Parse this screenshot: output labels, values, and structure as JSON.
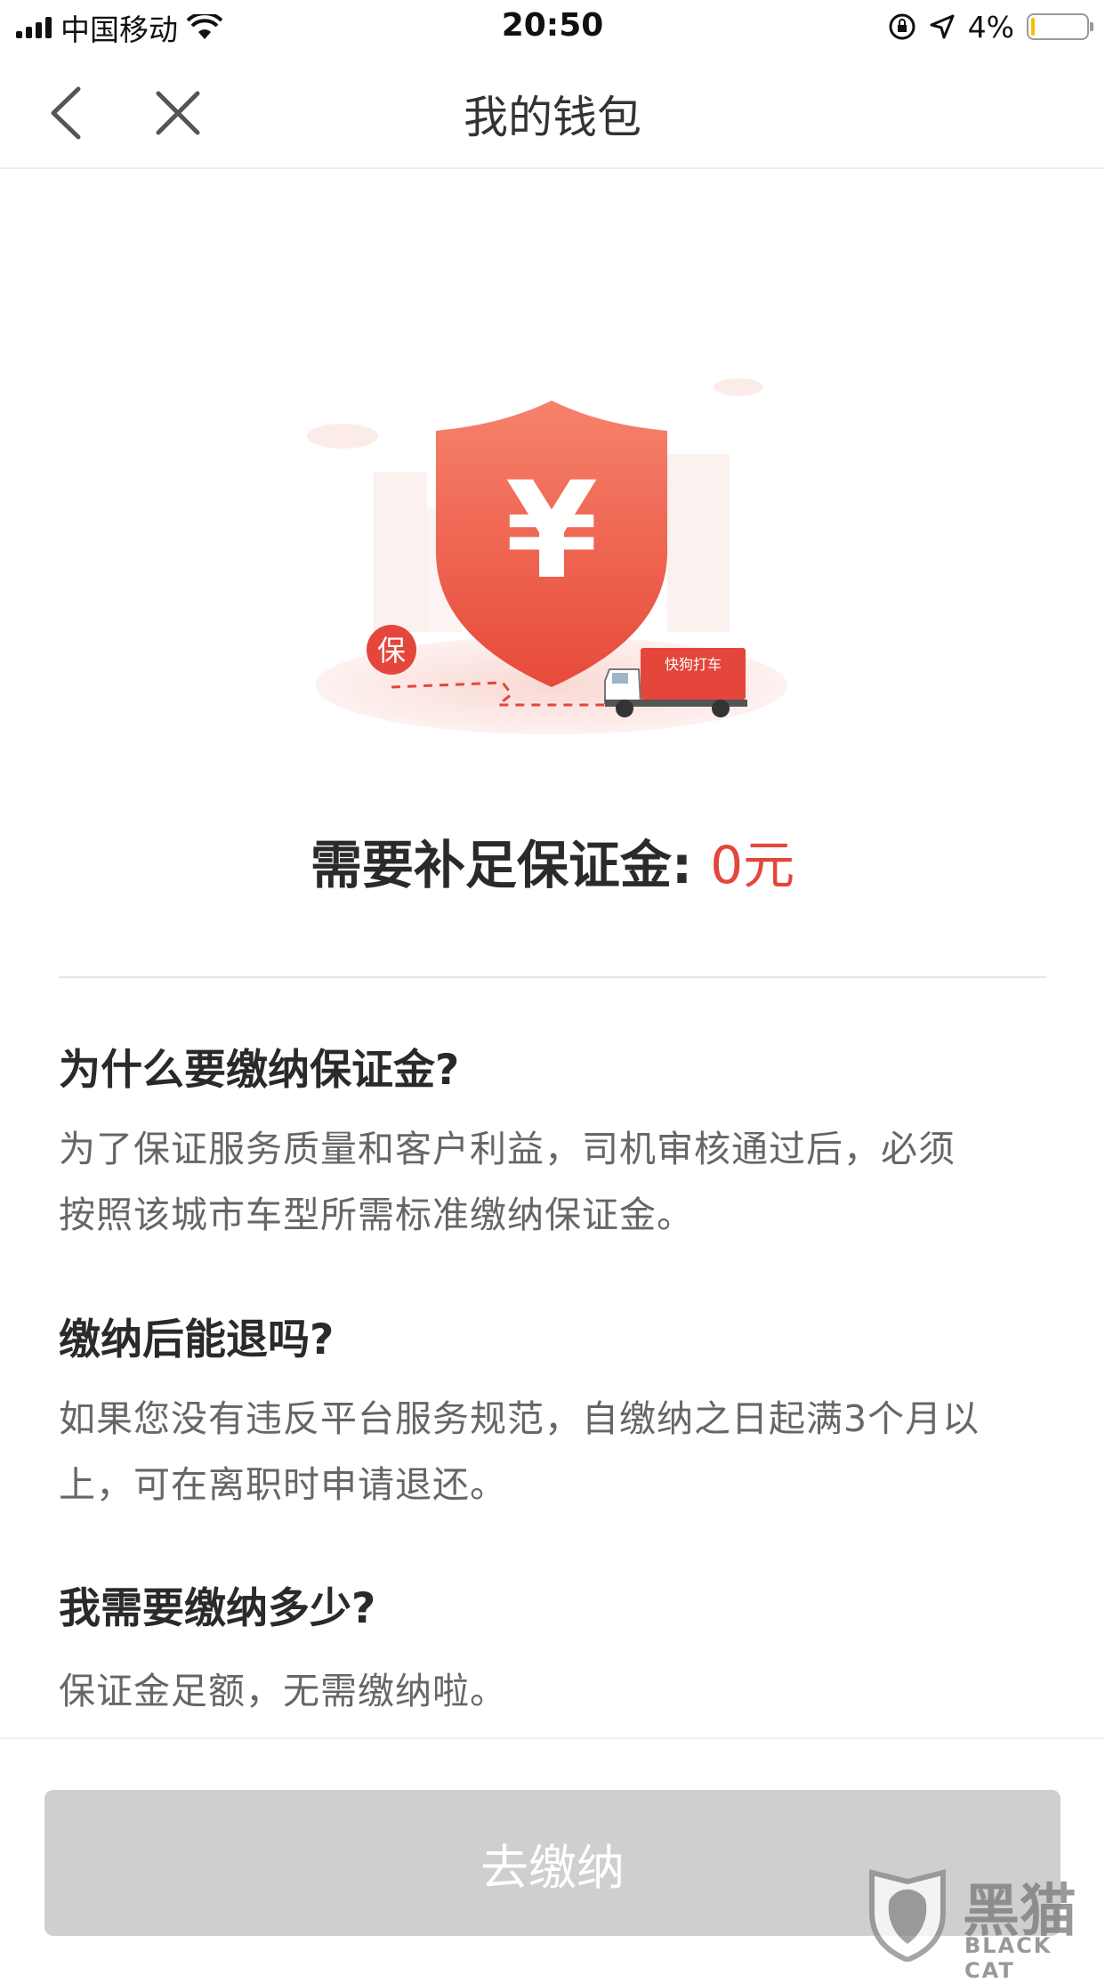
{
  "status_bar": {
    "carrier": "中国移动",
    "time": "20:50",
    "battery": "4%"
  },
  "nav": {
    "title": "我的钱包"
  },
  "illustration": {
    "shield_symbol": "¥",
    "badge_text": "保",
    "truck_text": "快狗打车"
  },
  "summary": {
    "label": "需要补足保证金:",
    "amount": "0元"
  },
  "faq": [
    {
      "question": "为什么要缴纳保证金?",
      "answer_lines": [
        "为了保证服务质量和客户利益，司机审核通过后，必须",
        "按照该城市车型所需标准缴纳保证金。"
      ]
    },
    {
      "question": "缴纳后能退吗?",
      "answer_lines": [
        "如果您没有违反平台服务规范，自缴纳之日起满3个月以",
        "上，可在离职时申请退还。"
      ]
    },
    {
      "question": "我需要缴纳多少?",
      "answer_lines": [
        "保证金足额，无需缴纳啦。"
      ]
    }
  ],
  "button": {
    "label": "去缴纳"
  },
  "watermark": {
    "cn": "黑猫",
    "en": "BLACK CAT"
  },
  "colors": {
    "accent_red": "#e4463b",
    "button_disabled": "#cfcfcf"
  }
}
